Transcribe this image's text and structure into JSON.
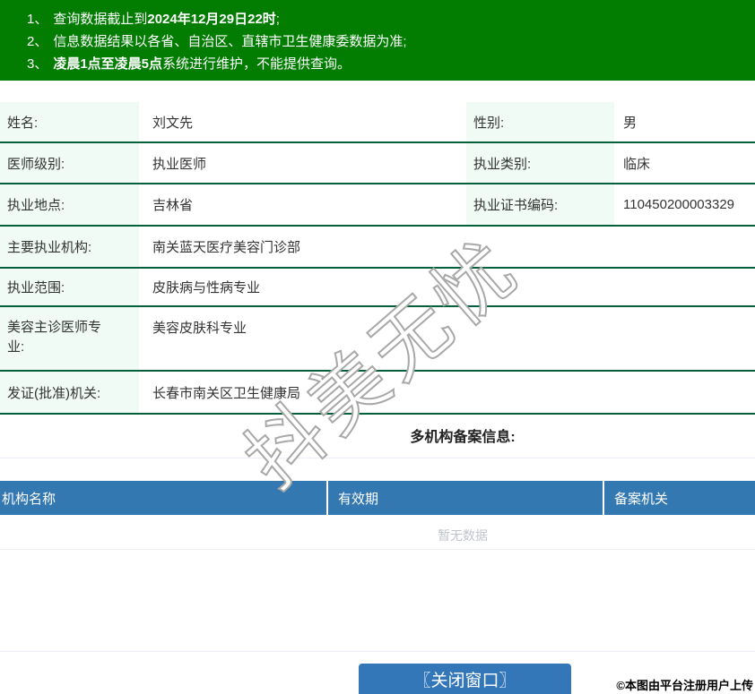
{
  "colors": {
    "banner_green": "#027d02",
    "row_rule_green": "#04603a",
    "label_mint": "#effbf4",
    "table_header_blue": "#3478b2",
    "button_blue": "#3377b8",
    "empty_text_gray": "#c0c4cc"
  },
  "notice": {
    "line1": {
      "num": "1、",
      "pre": "查询数据截止到",
      "bold": "2024年12月29日22时",
      "post": ";"
    },
    "line2": {
      "num": "2、",
      "pre": "信息数据结果以各省、自治区、直辖市卫生健康委数据为准;",
      "bold": "",
      "post": ""
    },
    "line3": {
      "num": "3、",
      "pre": "",
      "bold": "凌晨1点至凌晨5点",
      "post": "系统进行维护，不能提供查询。"
    }
  },
  "info": {
    "rows": [
      {
        "l1": "姓名:",
        "v1": "刘文先",
        "l2": "性别:",
        "v2": "男"
      },
      {
        "l1": "医师级别:",
        "v1": "执业医师",
        "l2": "执业类别:",
        "v2": "临床"
      },
      {
        "l1": "执业地点:",
        "v1": "吉林省",
        "l2": "执业证书编码:",
        "v2": "110450200003329"
      },
      {
        "l1": "主要执业机构:",
        "v1": "南关蓝天医疗美容门诊部"
      },
      {
        "l1": "执业范围:",
        "v1": "皮肤病与性病专业"
      },
      {
        "l1": "美容主诊医师专业:",
        "v1": "美容皮肤科专业"
      },
      {
        "l1": "发证(批准)机关:",
        "v1": "长春市南关区卫生健康局"
      }
    ]
  },
  "multi_org": {
    "title": "多机构备案信息:",
    "columns": [
      "机构名称",
      "有效期",
      "备案机关"
    ],
    "empty": "暂无数据"
  },
  "close_button": {
    "label": "〖关闭窗口〗"
  },
  "credit": "©本图由平台注册用户上传",
  "watermark": "抖美无忧"
}
